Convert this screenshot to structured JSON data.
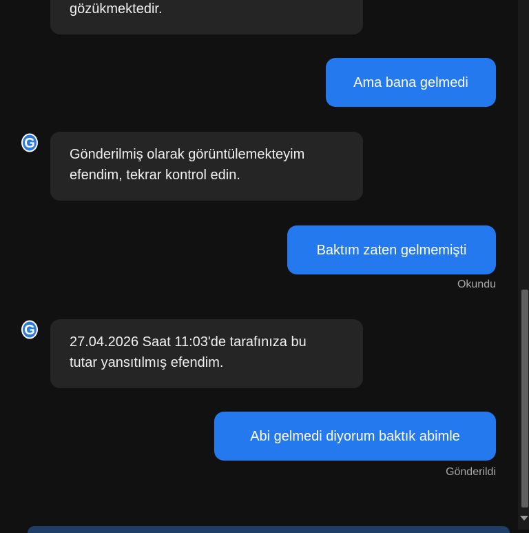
{
  "messages": [
    {
      "role": "bot",
      "text": "gözükmektedir."
    },
    {
      "role": "user",
      "text": "Ama bana gelmedi"
    },
    {
      "role": "bot",
      "lines": [
        "Gönderilmiş olarak görüntülemekteyim",
        "efendim, tekrar kontrol edin."
      ]
    },
    {
      "role": "user",
      "text": "Baktım zaten gelmemişti",
      "status": "Okundu"
    },
    {
      "role": "bot",
      "lines": [
        "27.04.2026 Saat 11:03'de tarafınıza bu",
        "tutar yansıtılmış efendim."
      ]
    },
    {
      "role": "user",
      "text": "Abi gelmedi diyorum baktık abimle",
      "status": "Gönderildi"
    }
  ],
  "avatar": {
    "letter": "G",
    "icon": "bot-avatar-g-icon",
    "color": "#2a7ae0"
  },
  "colors": {
    "user_bubble": "#2479ee",
    "bot_bubble": "#252525",
    "background": "#111111"
  }
}
